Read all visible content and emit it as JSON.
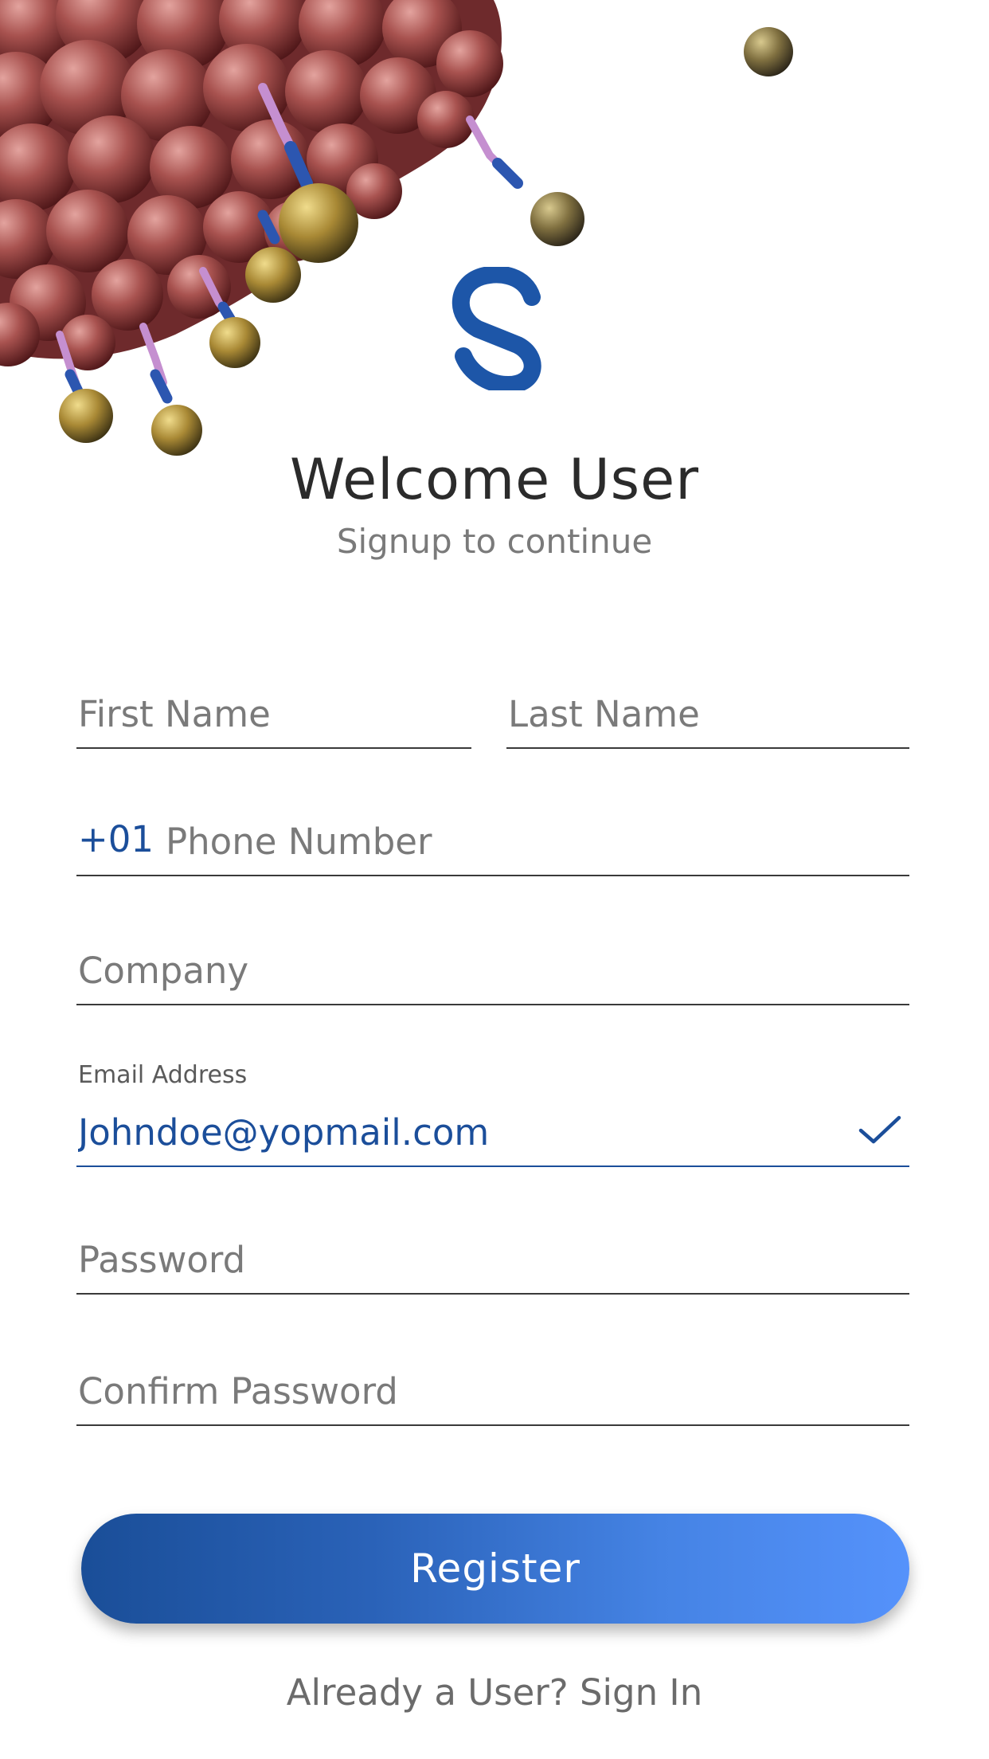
{
  "header": {
    "title": "Welcome User",
    "subtitle": "Signup to continue"
  },
  "form": {
    "first_name": {
      "placeholder": "First Name",
      "value": ""
    },
    "last_name": {
      "placeholder": "Last Name",
      "value": ""
    },
    "phone": {
      "prefix": "+01",
      "placeholder": "Phone Number",
      "value": ""
    },
    "company": {
      "placeholder": "Company",
      "value": ""
    },
    "email": {
      "label": "Email Address",
      "value": "Johndoe@yopmail.com",
      "valid": true
    },
    "password": {
      "placeholder": "Password",
      "value": ""
    },
    "confirm_password": {
      "placeholder": "Confirm Password",
      "value": ""
    }
  },
  "actions": {
    "register_label": "Register",
    "signin_link": "Already a User? Sign In"
  },
  "icons": {
    "logo": "s-logo-icon",
    "email_valid": "checkmark-icon"
  },
  "colors": {
    "brand_blue": "#1b4e9a",
    "button_gradient_start": "#1a4e98",
    "button_gradient_end": "#5592fb",
    "title_text": "#2b2b2b",
    "muted_text": "#7a7a7a"
  }
}
